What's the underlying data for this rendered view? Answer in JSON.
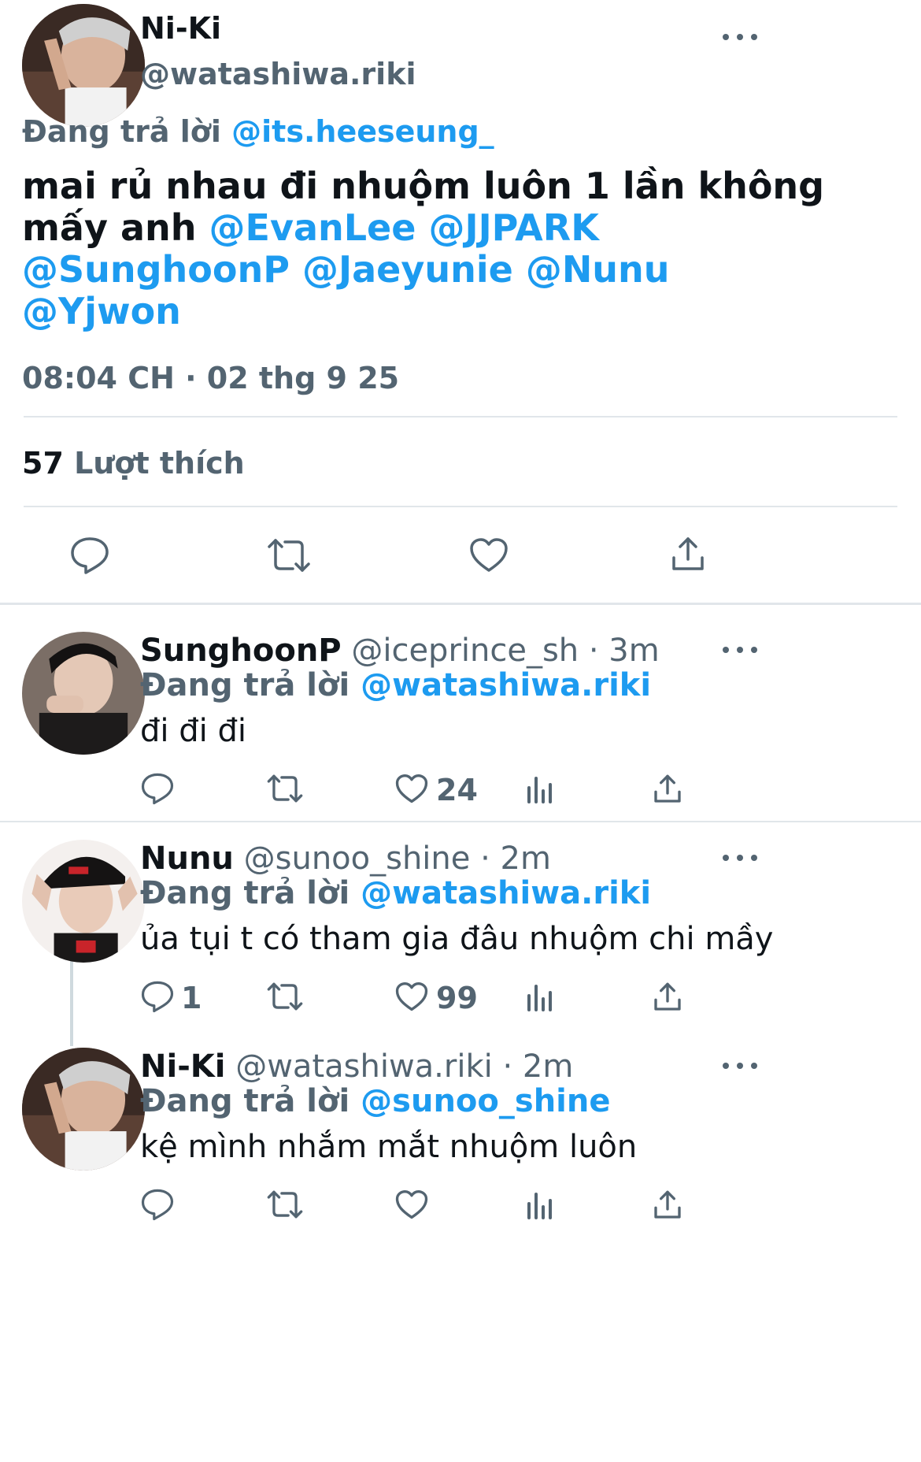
{
  "main_tweet": {
    "display_name": "Ni-Ki",
    "handle": "@watashiwa.riki",
    "replying_label": "Đang trả lời",
    "replying_to": "@its.heeseung_",
    "text_line1": "mai rủ nhau đi nhuộm luôn 1 lần không",
    "text_line2_plain": "mấy anh",
    "mentions": [
      "@EvanLee",
      "@JJPARK",
      "@SunghoonP",
      "@Jaeyunie",
      "@Nunu",
      "@Yjwon"
    ],
    "timestamp": "08:04 CH · 02 thg 9 25",
    "likes_count": "57",
    "likes_label": "Lượt thích"
  },
  "replies": [
    {
      "display_name": "SunghoonP",
      "handle": "@iceprince_sh",
      "time": "· 3m",
      "replying_label": "Đang trả lời",
      "replying_to": "@watashiwa.riki",
      "text": "đi đi đi",
      "reply_count": "",
      "like_count": "24"
    },
    {
      "display_name": "Nunu",
      "handle": "@sunoo_shine",
      "time": "· 2m",
      "replying_label": "Đang trả lời",
      "replying_to": "@watashiwa.riki",
      "text": "ủa tụi t có tham gia đâu nhuộm chi mầy",
      "reply_count": "1",
      "like_count": "99"
    },
    {
      "display_name": "Ni-Ki",
      "handle": "@watashiwa.riki",
      "time": "· 2m",
      "replying_label": "Đang trả lời",
      "replying_to": "@sunoo_shine",
      "text": "kệ mình nhắm mắt nhuộm luôn",
      "reply_count": "",
      "like_count": ""
    }
  ],
  "icons": {
    "reply": "comment-bubble-icon",
    "retweet": "retweet-icon",
    "like": "heart-icon",
    "views": "analytics-bars-icon",
    "share": "share-upload-icon",
    "more": "more-dots-icon"
  },
  "colors": {
    "link": "#1d9bf0",
    "secondary_text": "#536471",
    "divider": "#e1e6ea"
  }
}
